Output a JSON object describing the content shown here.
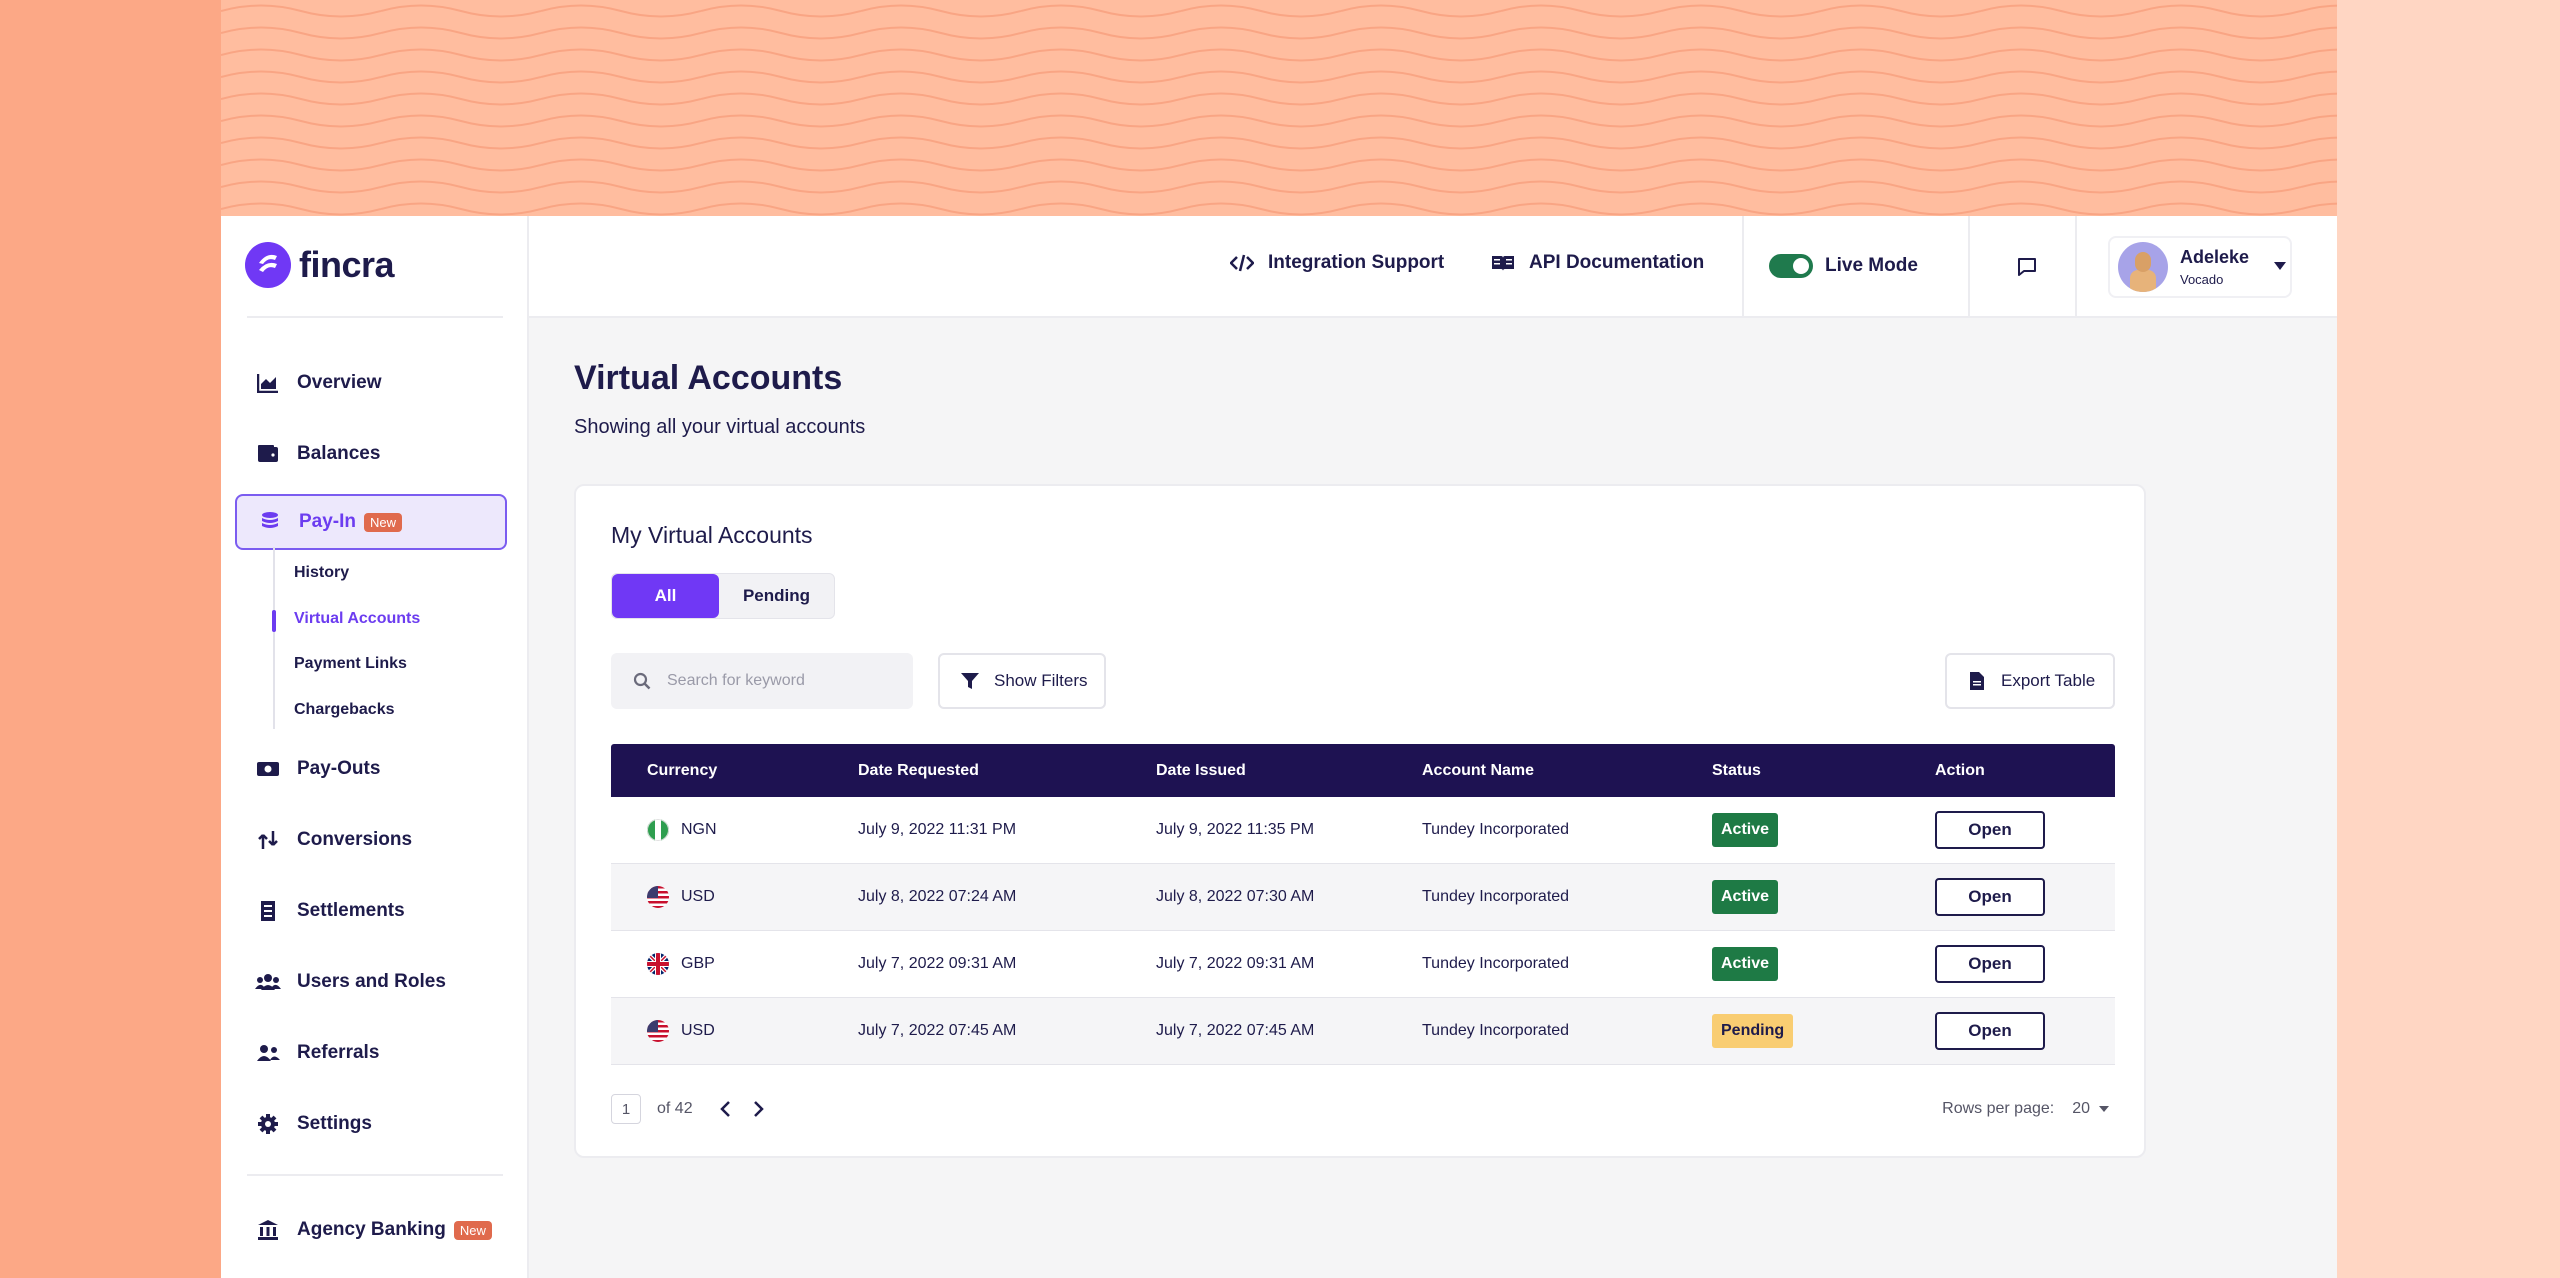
{
  "brand": {
    "name": "fincra"
  },
  "sidebar": {
    "items": [
      {
        "label": "Overview",
        "icon": "chart-area-icon"
      },
      {
        "label": "Balances",
        "icon": "wallet-icon"
      },
      {
        "label": "Pay-In",
        "icon": "coins-icon",
        "badge": "New",
        "active": true
      },
      {
        "label": "Pay-Outs",
        "icon": "money-bill-icon"
      },
      {
        "label": "Conversions",
        "icon": "exchange-icon"
      },
      {
        "label": "Settlements",
        "icon": "receipt-icon"
      },
      {
        "label": "Users and Roles",
        "icon": "users-icon"
      },
      {
        "label": "Referrals",
        "icon": "referral-icon"
      },
      {
        "label": "Settings",
        "icon": "gear-icon"
      }
    ],
    "subitems": [
      {
        "label": "History"
      },
      {
        "label": "Virtual Accounts",
        "active": true
      },
      {
        "label": "Payment Links"
      },
      {
        "label": "Chargebacks"
      }
    ],
    "agency": {
      "label": "Agency Banking",
      "badge": "New"
    }
  },
  "header": {
    "integration_support": "Integration Support",
    "api_docs": "API Documentation",
    "live_mode": "Live Mode",
    "user": {
      "name": "Adeleke",
      "org": "Vocado"
    }
  },
  "page": {
    "title": "Virtual Accounts",
    "subtitle": "Showing all your virtual accounts"
  },
  "card": {
    "title": "My Virtual Accounts",
    "tabs": [
      {
        "label": "All",
        "active": true
      },
      {
        "label": "Pending"
      }
    ],
    "search_placeholder": "Search for keyword",
    "show_filters": "Show Filters",
    "export": "Export Table"
  },
  "table": {
    "headers": [
      "Currency",
      "Date Requested",
      "Date Issued",
      "Account Name",
      "Status",
      "Action"
    ],
    "rows": [
      {
        "currency": "NGN",
        "flag": "ngn",
        "requested": "July 9, 2022 11:31 PM",
        "issued": "July 9, 2022 11:35 PM",
        "account": "Tundey Incorporated",
        "status": "Active",
        "action": "Open"
      },
      {
        "currency": "USD",
        "flag": "usd",
        "requested": "July 8, 2022 07:24 AM",
        "issued": "July 8, 2022 07:30 AM",
        "account": "Tundey Incorporated",
        "status": "Active",
        "action": "Open"
      },
      {
        "currency": "GBP",
        "flag": "gbp",
        "requested": "July 7, 2022 09:31 AM",
        "issued": "July 7, 2022 09:31 AM",
        "account": "Tundey Incorporated",
        "status": "Active",
        "action": "Open"
      },
      {
        "currency": "USD",
        "flag": "usd",
        "requested": "July 7, 2022 07:45 AM",
        "issued": "July 7, 2022 07:45 AM",
        "account": "Tundey Incorporated",
        "status": "Pending",
        "action": "Open"
      }
    ]
  },
  "pagination": {
    "page": "1",
    "of_text": "of 42",
    "rows_per_page_label": "Rows per page:",
    "rows_per_page": "20"
  },
  "colors": {
    "accent": "#7038f5",
    "dark": "#1e1252",
    "active": "#1e7a45",
    "pending": "#f9cd72",
    "badge": "#e06a4d"
  }
}
